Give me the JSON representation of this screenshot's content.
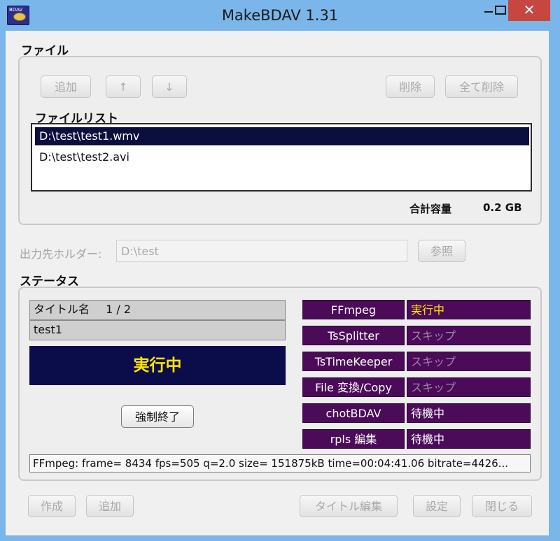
{
  "window": {
    "title": "MakeBDAV 1.31",
    "icon_text": "BDAV"
  },
  "file_section": {
    "label": "ファイル",
    "buttons": {
      "add": "追加",
      "up": "↑",
      "down": "↓",
      "delete": "削除",
      "delete_all": "全て削除"
    },
    "list_label": "ファイルリスト",
    "files": [
      "D:\\test\\test1.wmv",
      "D:\\test\\test2.avi"
    ],
    "selected_index": 0,
    "total_label": "合計容量",
    "total_value": "0.2 GB"
  },
  "output": {
    "label": "出力先ホルダー:",
    "value": "D:\\test",
    "browse": "参照"
  },
  "status_section": {
    "label": "ステータス",
    "title_label": "タイトル名",
    "title_index": "1 / 2",
    "title_value": "test1",
    "state": "実行中",
    "abort_button": "強制終了",
    "processes": [
      {
        "name": "FFmpeg",
        "status": "実行中"
      },
      {
        "name": "TsSplitter",
        "status": "スキップ"
      },
      {
        "name": "TsTimeKeeper",
        "status": "スキップ"
      },
      {
        "name": "File 変換/Copy",
        "status": "スキップ"
      },
      {
        "name": "chotBDAV",
        "status": "待機中"
      },
      {
        "name": "rpls 編集",
        "status": "待機中"
      }
    ],
    "log": "FFmpeg: frame= 8434 fps=505 q=2.0 size=  151875kB time=00:04:41.06 bitrate=4426..."
  },
  "bottom_buttons": {
    "create": "作成",
    "add": "追加",
    "title_edit": "タイトル編集",
    "settings": "設定",
    "close": "閉じる"
  },
  "colors": {
    "titlebar": "#7ab6e9",
    "close_button": "#c7463f",
    "selected_row": "#0a0f3d",
    "run_panel": "#0b0c4a",
    "run_text": "#ffe400",
    "process_bg": "#4b0b59",
    "status_running": "#ffe400",
    "status_skip": "#9a86a4",
    "status_wait": "#ffffff"
  }
}
